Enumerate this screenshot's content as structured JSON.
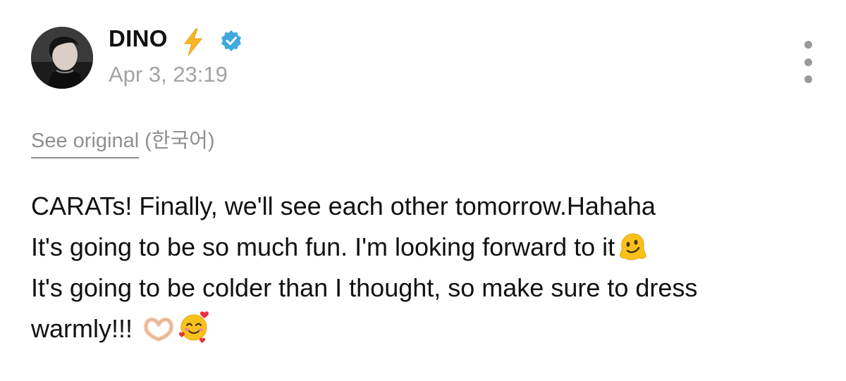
{
  "author": {
    "name": "DINO",
    "name_emoji": "⚡",
    "verified": true,
    "timestamp": "Apr 3, 23:19"
  },
  "icons": {
    "avatar": "profile-photo",
    "bolt": "lightning-bolt-icon",
    "verified": "verified-badge-icon",
    "more": "vertical-ellipsis-icon"
  },
  "colors": {
    "verified_badge": "#3fa9e0",
    "bolt": "#f7b826",
    "muted_text": "#a3a3a3"
  },
  "translation": {
    "see_original": "See original",
    "language": "(한국어)"
  },
  "body": {
    "lines": [
      "CARATs! Finally, we'll see each other tomorrow.Hahaha",
      "It's going to be so much fun. I'm looking forward to it",
      "It's going to be colder than I thought, so make sure to dress",
      "warmly!!! "
    ],
    "emoji_melting": "🫠",
    "emoji_heart_hands": "🫶🏻",
    "emoji_smiling_hearts": "🥰"
  }
}
